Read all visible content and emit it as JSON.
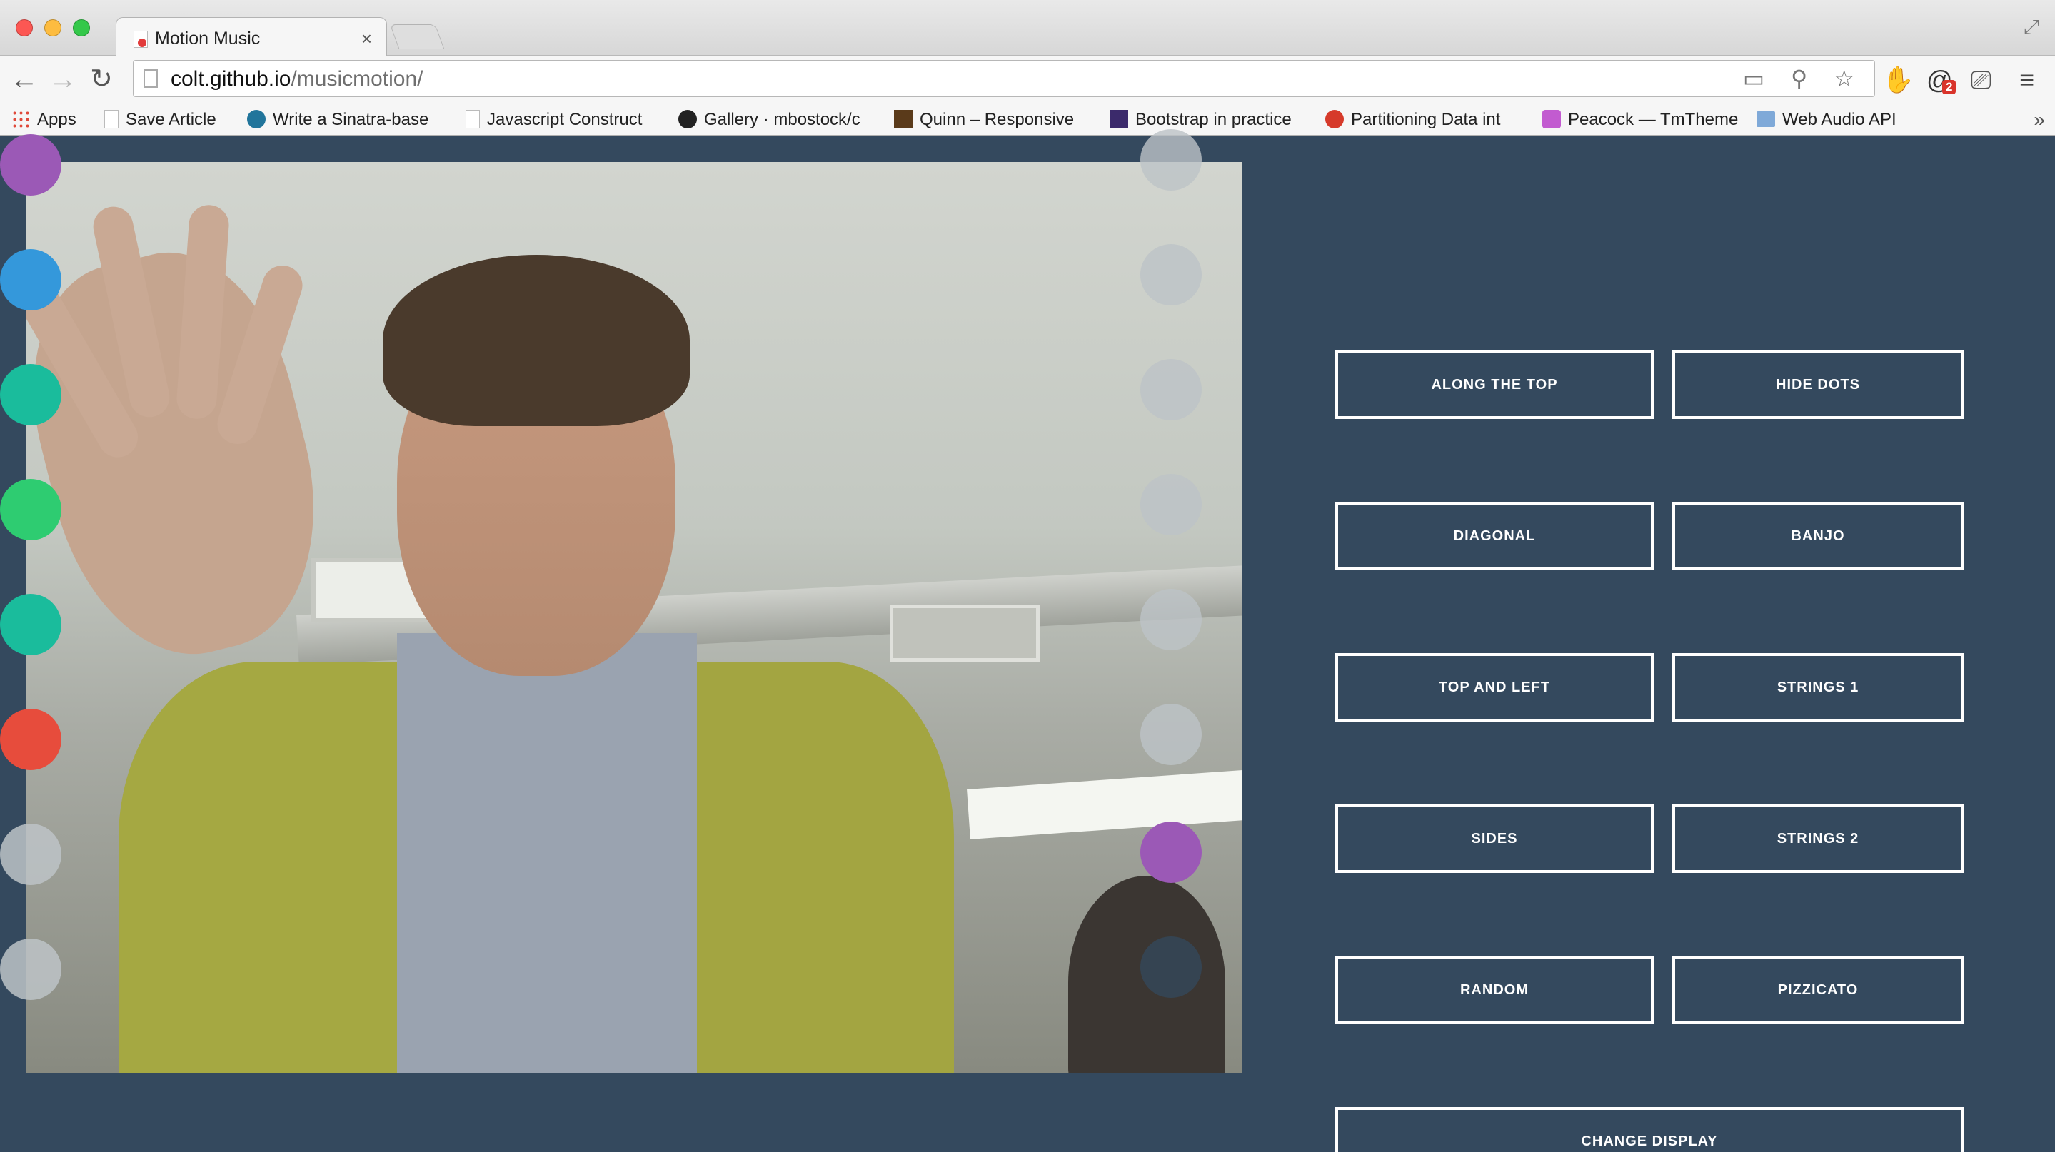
{
  "browser": {
    "tab_title": "Motion Music",
    "tab_close": "×",
    "url_host": "colt.github.io",
    "url_path": "/musicmotion/",
    "nav": {
      "back": "←",
      "forward": "→",
      "reload": "↻"
    },
    "omnibox_icons": "▭ ⚲ ☆",
    "extensions": {
      "stop": "✋",
      "at": "@",
      "at_badge": "2",
      "cast": "⎚",
      "menu": "≡"
    },
    "bookmarks": [
      {
        "label": "Apps",
        "icon": "apps-grid-icon",
        "color": "#e04a3b"
      },
      {
        "label": "Save Article",
        "icon": "page-icon",
        "color": "#dddddd"
      },
      {
        "label": "Write a Sinatra-base",
        "icon": "wordpress-icon",
        "color": "#21759b"
      },
      {
        "label": "Javascript Construct",
        "icon": "page-icon",
        "color": "#dddddd"
      },
      {
        "label": "Gallery · mbostock/c",
        "icon": "github-icon",
        "color": "#222222"
      },
      {
        "label": "Quinn – Responsive",
        "icon": "quinn-icon",
        "color": "#5a3a1a"
      },
      {
        "label": "Bootstrap in practice",
        "icon": "bootstrap-icon",
        "color": "#3b2a6b"
      },
      {
        "label": "Partitioning Data int",
        "icon": "gear-icon",
        "color": "#d63a2a"
      },
      {
        "label": "Peacock — TmTheme",
        "icon": "peacock-icon",
        "color": "#c25bd0"
      },
      {
        "label": "Web Audio API",
        "icon": "folder-icon",
        "color": "#7fa9d8"
      }
    ],
    "bookmarks_more": "»"
  },
  "page": {
    "background": "#34495e",
    "left_dots": [
      {
        "color": "#9b59b6"
      },
      {
        "color": "#3498db"
      },
      {
        "color": "#1abc9c"
      },
      {
        "color": "#2ecc71"
      },
      {
        "color": "#1abc9c"
      },
      {
        "color": "#e74c3c"
      },
      {
        "color": "#bdc3c7"
      },
      {
        "color": "#bdc3c7"
      }
    ],
    "right_dots": [
      {
        "color": "#bdc3c7"
      },
      {
        "color": "#bdc3c7"
      },
      {
        "color": "#bdc3c7"
      },
      {
        "color": "#bdc3c7"
      },
      {
        "color": "#bdc3c7"
      },
      {
        "color": "#bdc3c7"
      },
      {
        "color": "#9b59b6"
      },
      {
        "color": "#34495e"
      }
    ],
    "buttons": {
      "along_the_top": "ALONG THE TOP",
      "hide_dots": "HIDE DOTS",
      "diagonal": "DIAGONAL",
      "banjo": "BANJO",
      "top_and_left": "TOP AND LEFT",
      "strings_1": "STRINGS 1",
      "sides": "SIDES",
      "strings_2": "STRINGS 2",
      "random": "RANDOM",
      "pizzicato": "PIZZICATO",
      "change_display": "CHANGE DISPLAY"
    }
  }
}
